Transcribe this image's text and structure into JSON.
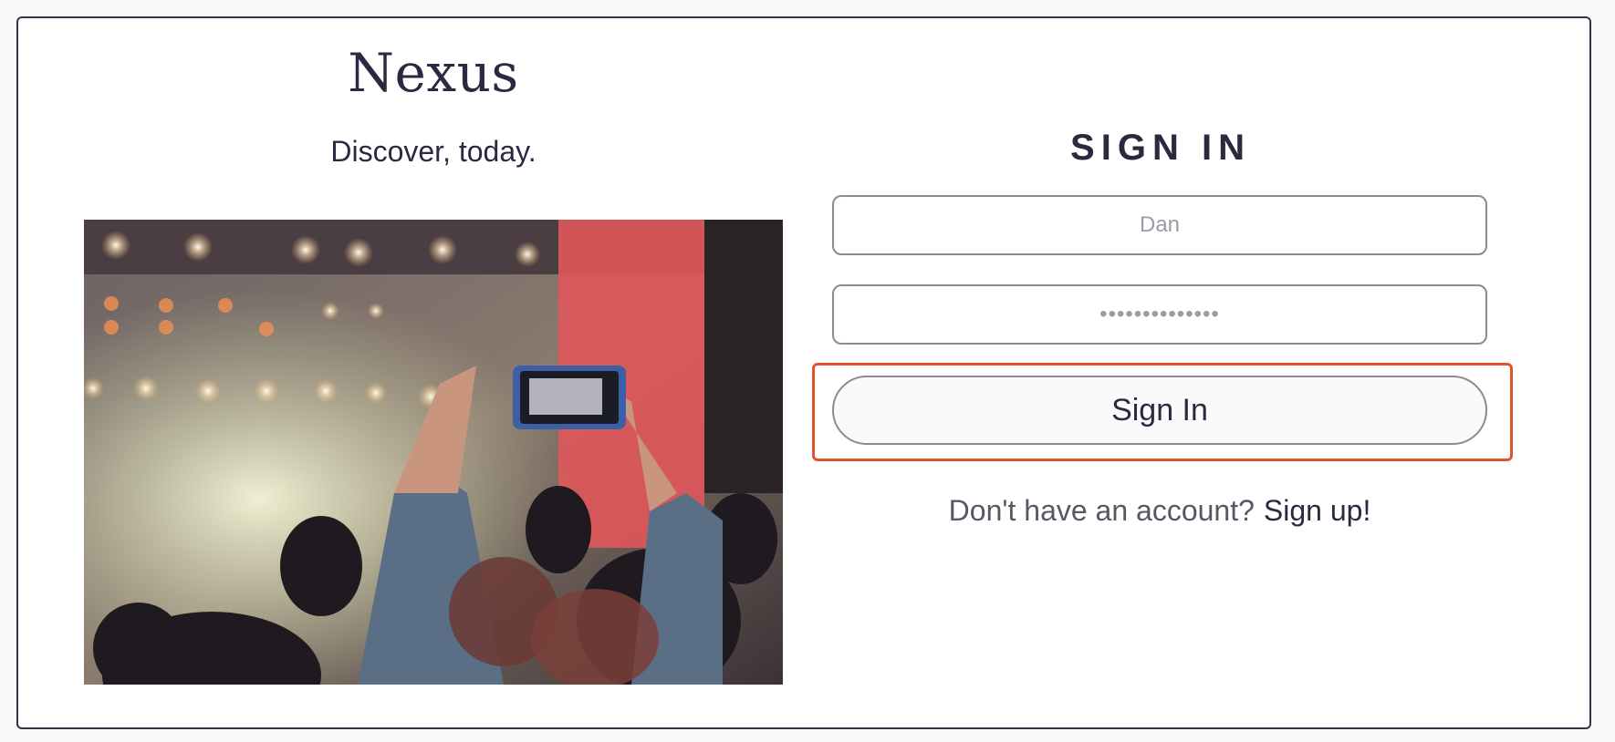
{
  "brand": {
    "name": "Nexus",
    "tagline": "Discover, today."
  },
  "hero_image": {
    "description_icon": "concert-photo"
  },
  "signin": {
    "title": "SIGN IN",
    "username_placeholder": "Dan",
    "password_placeholder": "••••••••••••••",
    "button_label": "Sign In",
    "no_account_text": "Don't have an account?",
    "signup_link": "Sign up!"
  },
  "colors": {
    "text": "#2f2740",
    "highlight": "#e0532b",
    "border": "#8c8a93"
  }
}
